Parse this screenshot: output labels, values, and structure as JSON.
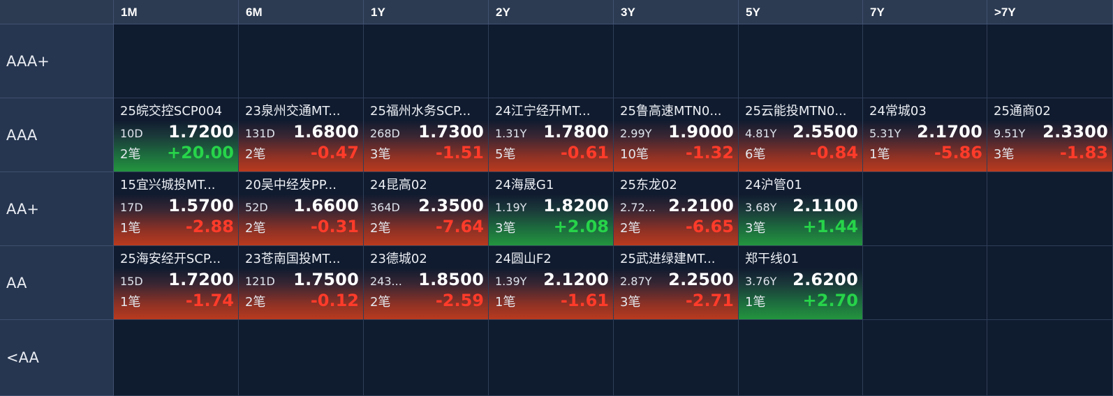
{
  "columns": [
    "",
    "1M",
    "6M",
    "1Y",
    "2Y",
    "3Y",
    "5Y",
    "7Y",
    ">7Y"
  ],
  "rows": [
    {
      "label": "AAA+",
      "cells": [
        null,
        null,
        null,
        null,
        null,
        null,
        null,
        null
      ]
    },
    {
      "label": "AAA",
      "cells": [
        {
          "name": "25皖交控SCP004",
          "term": "10D",
          "rate": "1.7200",
          "count": "2笔",
          "change": "+20.00",
          "trend": "green"
        },
        {
          "name": "23泉州交通MT...",
          "term": "131D",
          "rate": "1.6800",
          "count": "2笔",
          "change": "-0.47",
          "trend": "red"
        },
        {
          "name": "25福州水务SCP...",
          "term": "268D",
          "rate": "1.7300",
          "count": "3笔",
          "change": "-1.51",
          "trend": "red"
        },
        {
          "name": "24江宁经开MT...",
          "term": "1.31Y",
          "rate": "1.7800",
          "count": "5笔",
          "change": "-0.61",
          "trend": "red"
        },
        {
          "name": "25鲁高速MTN0...",
          "term": "2.99Y",
          "rate": "1.9000",
          "count": "10笔",
          "change": "-1.32",
          "trend": "red"
        },
        {
          "name": "25云能投MTN0...",
          "term": "4.81Y",
          "rate": "2.5500",
          "count": "6笔",
          "change": "-0.84",
          "trend": "red"
        },
        {
          "name": "24常城03",
          "term": "5.31Y",
          "rate": "2.1700",
          "count": "1笔",
          "change": "-5.86",
          "trend": "red"
        },
        {
          "name": "25通商02",
          "term": "9.51Y",
          "rate": "2.3300",
          "count": "3笔",
          "change": "-1.83",
          "trend": "red"
        }
      ]
    },
    {
      "label": "AA+",
      "cells": [
        {
          "name": "15宜兴城投MT...",
          "term": "17D",
          "rate": "1.5700",
          "count": "1笔",
          "change": "-2.88",
          "trend": "red"
        },
        {
          "name": "20吴中经发PP...",
          "term": "52D",
          "rate": "1.6600",
          "count": "2笔",
          "change": "-0.31",
          "trend": "red"
        },
        {
          "name": "24昆高02",
          "term": "364D",
          "rate": "2.3500",
          "count": "2笔",
          "change": "-7.64",
          "trend": "red"
        },
        {
          "name": "24海晟G1",
          "term": "1.19Y",
          "rate": "1.8200",
          "count": "3笔",
          "change": "+2.08",
          "trend": "green"
        },
        {
          "name": "25东龙02",
          "term": "2.72...",
          "rate": "2.2100",
          "count": "2笔",
          "change": "-6.65",
          "trend": "red"
        },
        {
          "name": "24沪管01",
          "term": "3.68Y",
          "rate": "2.1100",
          "count": "3笔",
          "change": "+1.44",
          "trend": "green"
        },
        null,
        null
      ]
    },
    {
      "label": "AA",
      "cells": [
        {
          "name": "25海安经开SCP...",
          "term": "15D",
          "rate": "1.7200",
          "count": "1笔",
          "change": "-1.74",
          "trend": "red"
        },
        {
          "name": "23苍南国投MT...",
          "term": "121D",
          "rate": "1.7500",
          "count": "2笔",
          "change": "-0.12",
          "trend": "red"
        },
        {
          "name": "23德城02",
          "term": "243...",
          "rate": "1.8500",
          "count": "2笔",
          "change": "-2.59",
          "trend": "red"
        },
        {
          "name": "24圆山F2",
          "term": "1.39Y",
          "rate": "2.1200",
          "count": "1笔",
          "change": "-1.61",
          "trend": "red"
        },
        {
          "name": "25武进绿建MT...",
          "term": "2.87Y",
          "rate": "2.2500",
          "count": "3笔",
          "change": "-2.71",
          "trend": "red"
        },
        {
          "name": "郑干线01",
          "term": "3.76Y",
          "rate": "2.6200",
          "count": "1笔",
          "change": "+2.70",
          "trend": "green"
        },
        null,
        null
      ]
    },
    {
      "label": "<AA",
      "cells": [
        null,
        null,
        null,
        null,
        null,
        null,
        null,
        null
      ]
    }
  ],
  "colors": {
    "header_bg": "#2c3b52",
    "row_label_bg": "#263650",
    "cell_bg": "#0f1b2f",
    "up_green": "#27d44a",
    "down_red": "#ff3b2a"
  }
}
